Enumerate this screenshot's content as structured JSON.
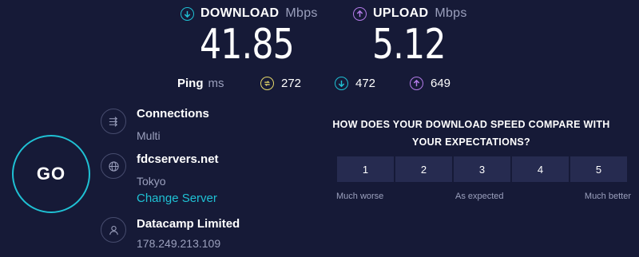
{
  "download": {
    "label": "DOWNLOAD",
    "unit": "Mbps",
    "value": "41.85",
    "color": "#1fc1d4",
    "icon": "arrow-down-circle-icon"
  },
  "upload": {
    "label": "UPLOAD",
    "unit": "Mbps",
    "value": "5.12",
    "color": "#b37be8",
    "icon": "arrow-up-circle-icon"
  },
  "ping": {
    "label": "Ping",
    "unit": "ms",
    "idle": {
      "value": "272",
      "color": "#e6d86a",
      "icon": "ping-idle-icon"
    },
    "download": {
      "value": "472",
      "color": "#1fc1d4",
      "icon": "ping-download-icon"
    },
    "upload": {
      "value": "649",
      "color": "#b37be8",
      "icon": "ping-upload-icon"
    }
  },
  "go_button": {
    "label": "GO",
    "color": "#1fc1d4"
  },
  "connections": {
    "title": "Connections",
    "value": "Multi",
    "icon": "connections-icon"
  },
  "server": {
    "title": "fdcservers.net",
    "location": "Tokyo",
    "change_label": "Change Server",
    "icon": "globe-icon"
  },
  "provider": {
    "title": "Datacamp Limited",
    "ip": "178.249.213.109",
    "icon": "user-icon"
  },
  "survey": {
    "question_line1": "HOW DOES YOUR DOWNLOAD SPEED COMPARE WITH",
    "question_line2": "YOUR EXPECTATIONS?",
    "options": [
      "1",
      "2",
      "3",
      "4",
      "5"
    ],
    "caption_low": "Much worse",
    "caption_mid": "As expected",
    "caption_high": "Much better"
  }
}
